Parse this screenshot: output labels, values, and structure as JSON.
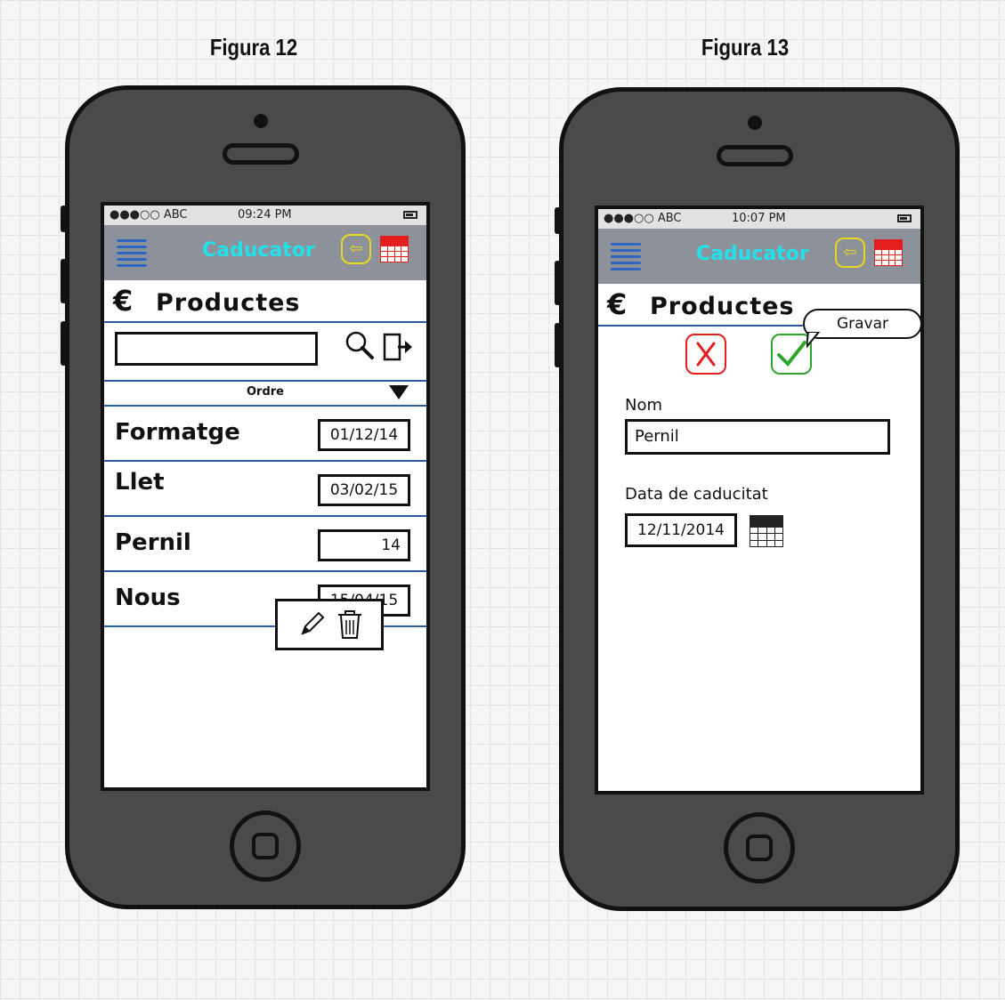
{
  "figures": [
    {
      "label": "Figura 12"
    },
    {
      "label": "Figura 13"
    }
  ],
  "screen1": {
    "status": {
      "carrier": "●●●○○ ABC",
      "time": "09:24 PM"
    },
    "app_title": "Caducator",
    "section_title": "Productes",
    "search": {
      "value": ""
    },
    "order_label": "Ordre",
    "items": [
      {
        "name": "Formatge",
        "date": "01/12/14"
      },
      {
        "name": "Llet",
        "date": "03/02/15"
      },
      {
        "name": "Pernil",
        "date": "14"
      },
      {
        "name": "Nous",
        "date": "15/04/15"
      }
    ],
    "context_menu": [
      "edit-icon",
      "trash-icon"
    ]
  },
  "screen2": {
    "status": {
      "carrier": "●●●○○ ABC",
      "time": "10:07 PM"
    },
    "app_title": "Caducator",
    "section_title": "Productes",
    "tooltip": "Gravar",
    "name_label": "Nom",
    "name_value": "Pernil",
    "date_label": "Data de caducitat",
    "date_value": "12/11/2014"
  },
  "colors": {
    "navbar": "#8d929a",
    "app_title": "#24e0ea",
    "accent_blue": "#2b5aa8",
    "back_button": "#e6d820",
    "calendar_red": "#e31e1e",
    "cancel_red": "#e31e1e",
    "save_green": "#2aa62a",
    "phone_body": "#4a4a4a"
  }
}
